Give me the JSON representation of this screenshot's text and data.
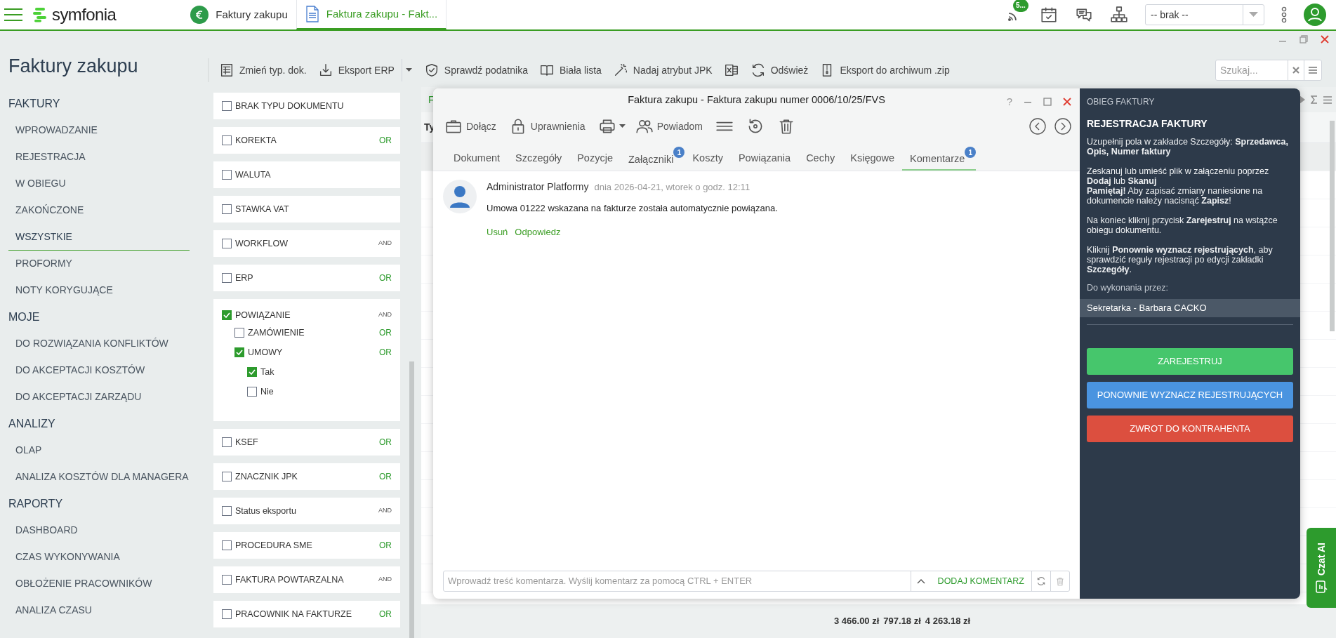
{
  "app": {
    "logo": "symfonia",
    "tabs": [
      {
        "label": "Faktury zakupu",
        "selected": false
      },
      {
        "label": "Faktura zakupu - Fakt...",
        "selected": true
      }
    ],
    "notification_badge": "5...",
    "company_select": "-- brak --"
  },
  "sidebar": {
    "title": "Faktury zakupu",
    "sections": [
      {
        "heading": "FAKTURY",
        "items": [
          {
            "label": "WPROWADZANIE",
            "selected": false
          },
          {
            "label": "REJESTRACJA",
            "selected": false
          },
          {
            "label": "W OBIEGU",
            "selected": false
          },
          {
            "label": "ZAKOŃCZONE",
            "selected": false
          },
          {
            "label": "WSZYSTKIE",
            "selected": true
          },
          {
            "label": "PROFORMY",
            "selected": false
          },
          {
            "label": "NOTY KORYGUJĄCE",
            "selected": false
          }
        ]
      },
      {
        "heading": "MOJE",
        "items": [
          {
            "label": "DO ROZWIĄZANIA KONFLIKTÓW",
            "selected": false
          },
          {
            "label": "DO AKCEPTACJI KOSZTÓW",
            "selected": false
          },
          {
            "label": "DO AKCEPTACJI ZARZĄDU",
            "selected": false
          }
        ]
      },
      {
        "heading": "ANALIZY",
        "items": [
          {
            "label": "OLAP",
            "selected": false
          },
          {
            "label": "ANALIZA KOSZTÓW DLA MANAGERA",
            "selected": false
          }
        ]
      },
      {
        "heading": "RAPORTY",
        "items": [
          {
            "label": "DASHBOARD",
            "selected": false
          },
          {
            "label": "CZAS WYKONYWANIA",
            "selected": false
          },
          {
            "label": "OBŁOŻENIE PRACOWNIKÓW",
            "selected": false
          },
          {
            "label": "ANALIZA CZASU",
            "selected": false
          }
        ]
      }
    ]
  },
  "toolbar": {
    "buttons": [
      {
        "kind": "labeled",
        "label": "Zmień typ. dok."
      },
      {
        "kind": "labeled",
        "label": "Eksport ERP",
        "dropdown": true
      },
      {
        "kind": "labeled",
        "label": "Sprawdź podatnika"
      },
      {
        "kind": "labeled",
        "label": "Biała lista"
      },
      {
        "kind": "labeled",
        "label": "Nadaj atrybut JPK"
      },
      {
        "kind": "icon"
      },
      {
        "kind": "labeled",
        "label": "Odśwież"
      },
      {
        "kind": "labeled",
        "label": "Eksport do archiwum .zip"
      }
    ],
    "search": {
      "placeholder": "Szukaj..."
    }
  },
  "filters": [
    {
      "label": "BRAK TYPU DOKUMENTU",
      "checked": false
    },
    {
      "label": "KOREKTA",
      "checked": false,
      "op": "OR"
    },
    {
      "label": "WALUTA",
      "checked": false
    },
    {
      "label": "STAWKA VAT",
      "checked": false
    },
    {
      "label": "WORKFLOW",
      "checked": false,
      "op": "AND"
    },
    {
      "label": "ERP",
      "checked": false,
      "op": "OR"
    },
    {
      "label": "POWIĄZANIE",
      "checked": true,
      "op": "AND",
      "children": [
        {
          "label": "ZAMÓWIENIE",
          "checked": false,
          "op": "OR"
        },
        {
          "label": "UMOWY",
          "checked": true,
          "op": "OR",
          "children": [
            {
              "label": "Tak",
              "checked": true
            },
            {
              "label": "Nie",
              "checked": false
            }
          ]
        }
      ]
    },
    {
      "label": "KSEF",
      "checked": false,
      "op": "OR"
    },
    {
      "label": "ZNACZNIK JPK",
      "checked": false,
      "op": "OR"
    },
    {
      "label": "Status eksportu",
      "checked": false,
      "op": "AND"
    },
    {
      "label": "PROCEDURA SME",
      "checked": false,
      "op": "OR"
    },
    {
      "label": "FAKTURA POWTARZALNA",
      "checked": false,
      "op": "AND"
    },
    {
      "label": "PRACOWNIK NA FAKTURZE",
      "checked": false,
      "op": "OR"
    }
  ],
  "grid": {
    "toolbar_text": "F",
    "column_1": "Ty",
    "totals": [
      "3 466.00 zł",
      "797.18 zł",
      "4 263.18 zł"
    ]
  },
  "modal": {
    "title": "Faktura zakupu - Faktura zakupu numer 0006/10/25/FVS",
    "help": "?",
    "toolbar": [
      {
        "kind": "labeled",
        "label": "Dołącz"
      },
      {
        "kind": "labeled",
        "label": "Uprawnienia"
      },
      {
        "kind": "icon",
        "dropdown": true
      },
      {
        "kind": "labeled",
        "label": "Powiadom"
      },
      {
        "kind": "icon"
      },
      {
        "kind": "icon"
      },
      {
        "kind": "icon"
      }
    ],
    "tabs": [
      {
        "label": "Dokument",
        "selected": false
      },
      {
        "label": "Szczegóły",
        "selected": false
      },
      {
        "label": "Pozycje",
        "selected": false
      },
      {
        "label": "Załączniki",
        "selected": false,
        "badge": "1"
      },
      {
        "label": "Koszty",
        "selected": false
      },
      {
        "label": "Powiązania",
        "selected": false
      },
      {
        "label": "Cechy",
        "selected": false
      },
      {
        "label": "Księgowe",
        "selected": false
      },
      {
        "label": "Komentarze",
        "selected": true,
        "badge": "1"
      }
    ],
    "comments": [
      {
        "author": "Administrator Platformy",
        "date": "dnia 2026-04-21, wtorek o godz. 12:11",
        "text": "Umowa 01222 wskazana na fakturze została automatycznie powiązana.",
        "actions": [
          "Usuń",
          "Odpowiedz"
        ]
      }
    ],
    "comment_input": {
      "placeholder": "Wprowadź treść komentarza. Wyślij komentarz za pomocą CTRL + ENTER"
    },
    "add_button": "DODAJ KOMENTARZ"
  },
  "workflow": {
    "heading": "OBIEG FAKTURY",
    "title": "REJESTRACJA FAKTURY",
    "instructions": [
      [
        "Uzupełnij pola w zakładce Szczegóły: **Sprzedawca, Opis, Numer faktury**"
      ],
      [
        "Zeskanuj lub umieść plik w załączeniu poprzez **Dodaj** lub **Skanuj**",
        "**Pamiętaj!** Aby zapisać zmiany naniesione na dokumencie należy nacisnąć **Zapisz**!"
      ],
      [
        "Na koniec kliknij przycisk **Zarejestruj** na wstążce obiegu dokumentu."
      ],
      [
        "Kliknij **Ponownie wyznacz rejestrujących**, aby sprawdzić reguły rejestracji po edycji zakładki **Szczegóły**."
      ]
    ],
    "assignee_label": "Do wykonania przez:",
    "assignee": "Sekretarka - Barbara CACKO",
    "buttons": [
      {
        "label": "ZAREJESTRUJ",
        "color": "#46c66c"
      },
      {
        "label": "PONOWNIE WYZNACZ REJESTRUJĄCYCH",
        "color": "#4a94e0"
      },
      {
        "label": "ZWROT DO KONTRAHENTA",
        "color": "#dc4f3f"
      }
    ]
  },
  "chat": {
    "label": "Czat AI"
  }
}
